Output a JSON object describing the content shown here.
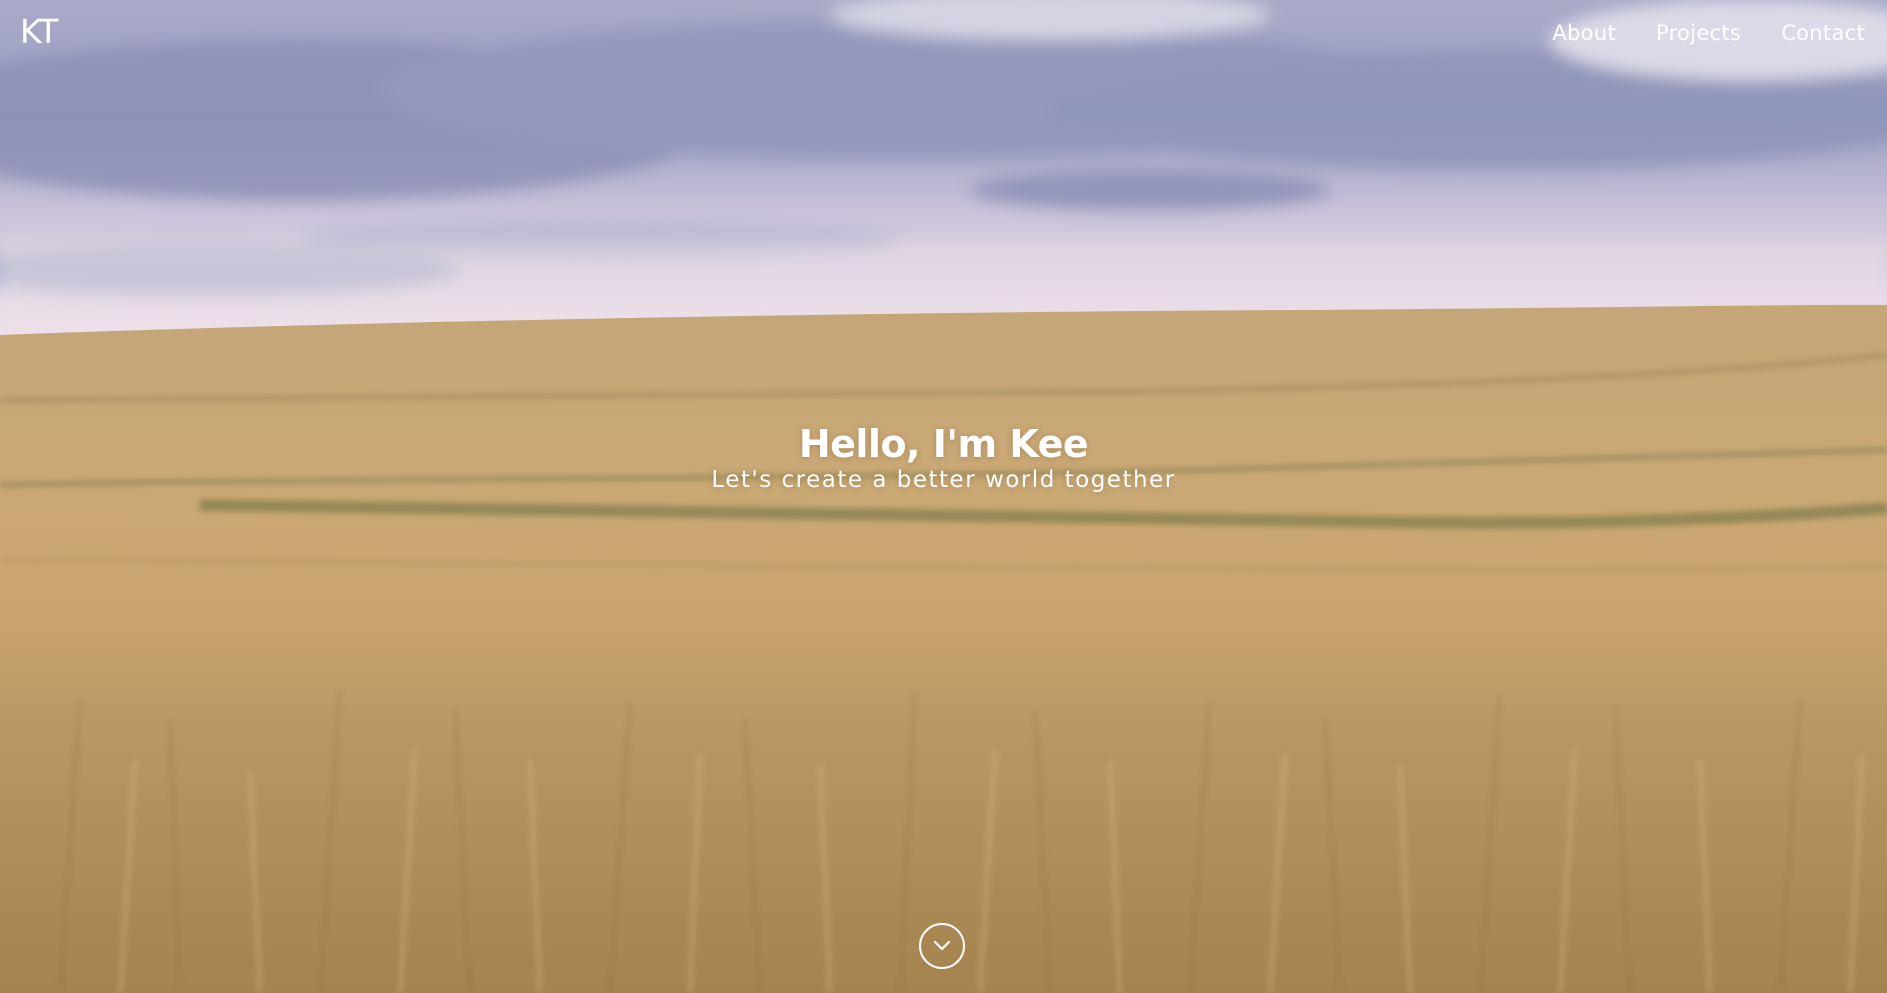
{
  "nav": {
    "logo": "KT",
    "links": [
      {
        "label": "About"
      },
      {
        "label": "Projects"
      },
      {
        "label": "Contact"
      }
    ]
  },
  "hero": {
    "title": "Hello, I'm Kee",
    "subtitle": "Let's create a better world together",
    "scroll_icon": "chevron-down-icon"
  },
  "colors": {
    "text": "#ffffff",
    "sky": "#9fa3c5",
    "wheat": "#c7a671"
  }
}
